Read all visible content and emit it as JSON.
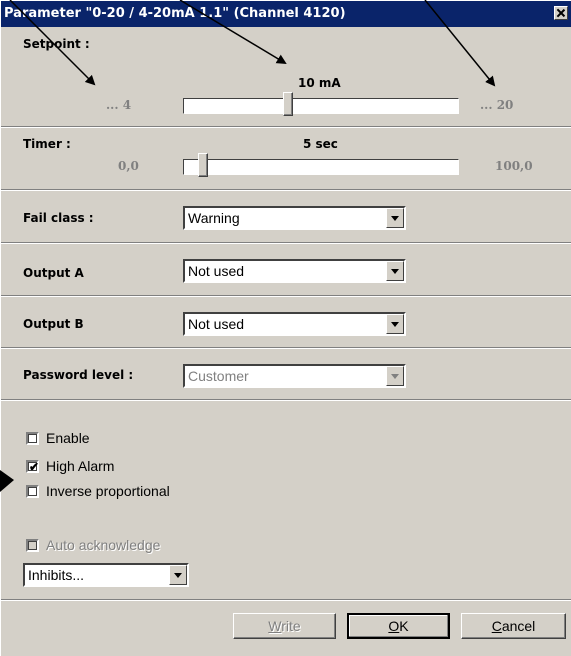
{
  "window": {
    "title": "Parameter \"0-20 / 4-20mA 1.1\" (Channel 4120)"
  },
  "setpoint": {
    "label": "Setpoint :",
    "value": "10 mA",
    "min_label": "... 4",
    "max_label": "... 20",
    "min": 4,
    "max": 20,
    "current": 10
  },
  "timer": {
    "label": "Timer :",
    "value": "5 sec",
    "min_label": "0,0",
    "max_label": "100,0",
    "min": 0,
    "max": 100,
    "current": 5
  },
  "fail_class": {
    "label": "Fail class :",
    "selected": "Warning"
  },
  "output_a": {
    "label": "Output A",
    "selected": "Not used"
  },
  "output_b": {
    "label": "Output B",
    "selected": "Not used"
  },
  "password_level": {
    "label": "Password level :",
    "selected": "Customer",
    "disabled": true
  },
  "checkboxes": [
    {
      "label": "Enable",
      "checked": false
    },
    {
      "label": "High Alarm",
      "checked": true
    },
    {
      "label": "Inverse proportional",
      "checked": false
    }
  ],
  "auto_ack": {
    "label": "Auto acknowledge",
    "checked": false,
    "disabled": true
  },
  "inhibits": {
    "selected": "Inhibits..."
  },
  "buttons": {
    "write": "Write",
    "ok": "OK",
    "cancel": "Cancel"
  },
  "colors": {
    "titlebar": "#0a246a",
    "face": "#d4d0c8"
  }
}
